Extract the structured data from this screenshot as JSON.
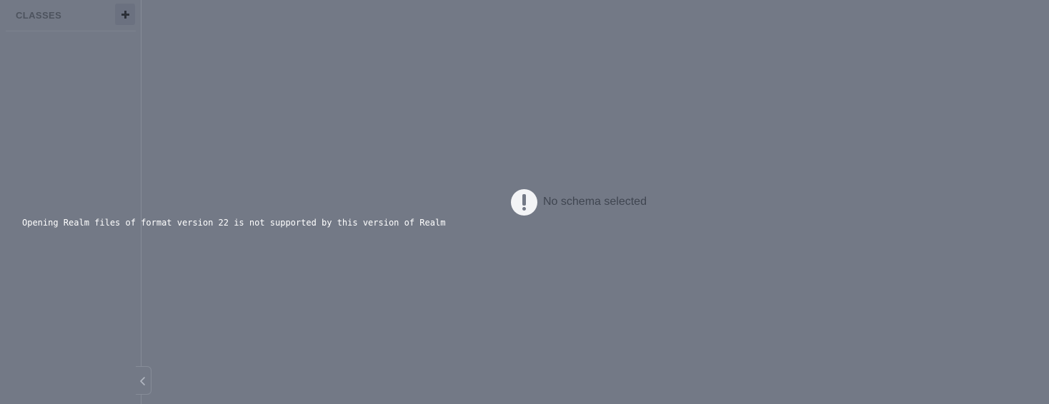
{
  "sidebar": {
    "title": "CLASSES",
    "add_button_icon": "plus-icon",
    "collapse_icon": "chevron-left-icon"
  },
  "main": {
    "empty_state": {
      "icon": "exclamation-icon",
      "text": "No schema selected"
    }
  },
  "error": {
    "message": "Opening Realm files of format version 22 is not supported by this version of Realm"
  },
  "colors": {
    "overlay_background": "#737986",
    "error_text": "#ffffff"
  }
}
